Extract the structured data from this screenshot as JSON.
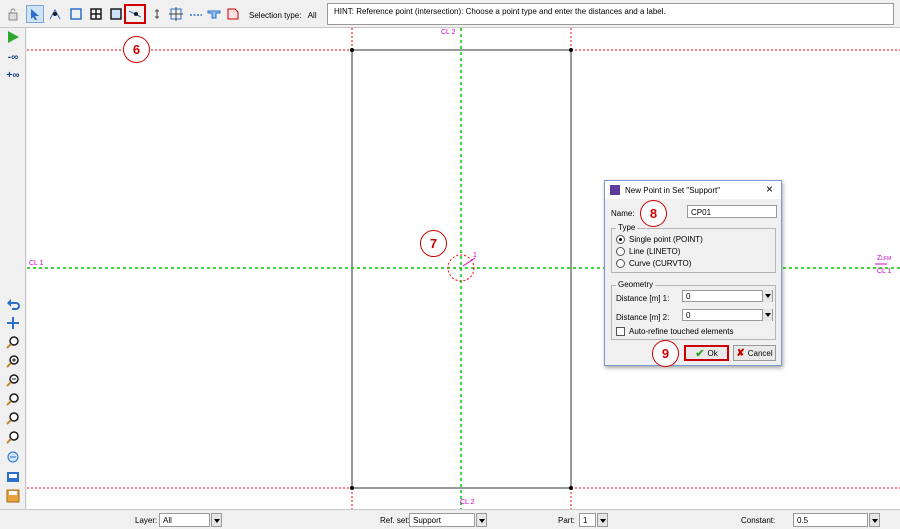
{
  "toolbar": {
    "selection_type_label": "Selection type:",
    "selection_type_value": "All",
    "hint": "HINT: Reference point (intersection): Choose a point type and enter the distances and a label."
  },
  "leftbar": {
    "zoom_minus_label": "-∞",
    "zoom_plus_label": "+∞"
  },
  "canvas": {
    "axis_label_cl2_top": "CL 2",
    "axis_label_cl2_bottom": "CL 2",
    "axis_label_cl1_left": "CL 1",
    "axis_label_cl1_right": "CL 1",
    "axis_label_z": "Z",
    "axis_label_lfm": "LFM",
    "point_label": "1",
    "accent_green": "#00cc00",
    "accent_red": "#ff0000",
    "accent_magenta": "#cc00cc"
  },
  "callouts": {
    "c6": "6",
    "c7": "7",
    "c8": "8",
    "c9": "9"
  },
  "dialog": {
    "title": "New Point in Set \"Support\"",
    "name_label": "Name:",
    "name_value": "CP01",
    "type_group": "Type",
    "type_options": [
      "Single point (POINT)",
      "Line (LINETO)",
      "Curve (CURVTO)"
    ],
    "geometry_group": "Geometry",
    "distance1_label": "Distance [m] 1:",
    "distance1_value": "0",
    "distance2_label": "Distance [m] 2:",
    "distance2_value": "0",
    "autorefine_label": "Auto-refine touched elements",
    "ok_label": "Ok",
    "cancel_label": "Cancel"
  },
  "statusbar": {
    "layer_label": "Layer:",
    "layer_value": "All",
    "refset_label": "Ref. set:",
    "refset_value": "Support",
    "part_label": "Part:",
    "part_value": "1",
    "constant_label": "Constant:",
    "constant_value": "0.5"
  }
}
